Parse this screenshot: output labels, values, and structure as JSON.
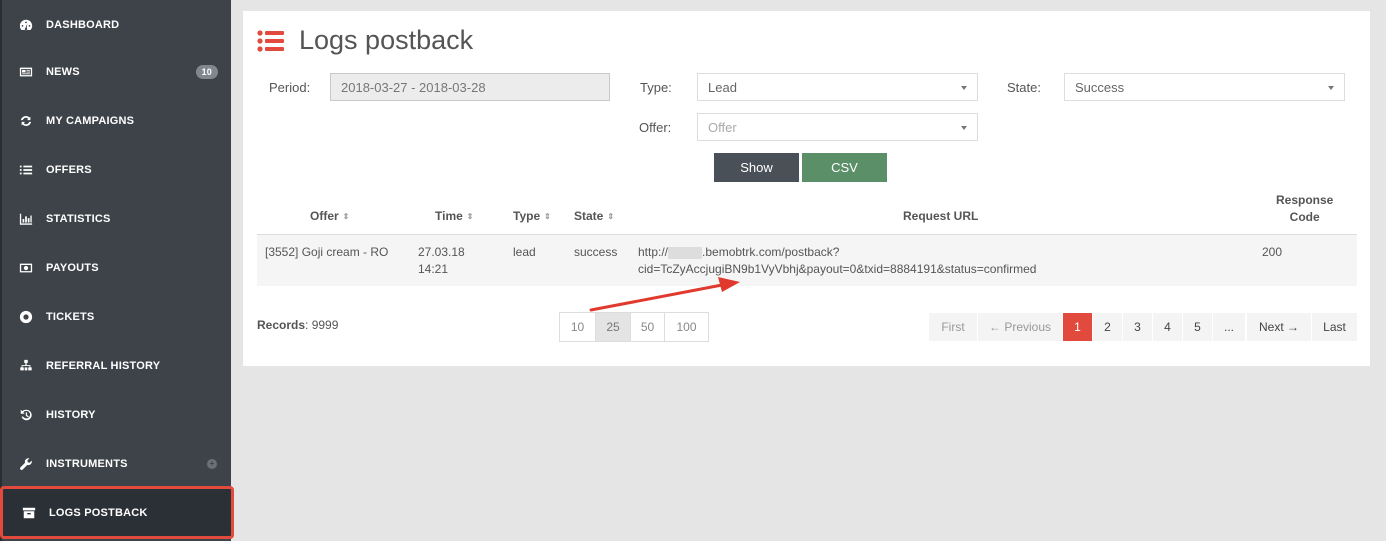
{
  "sidebar": {
    "items": [
      {
        "label": "DASHBOARD",
        "icon": "dashboard-icon"
      },
      {
        "label": "NEWS",
        "icon": "newspaper-icon",
        "badge": "10"
      },
      {
        "label": "MY CAMPAIGNS",
        "icon": "refresh-icon"
      },
      {
        "label": "OFFERS",
        "icon": "list-icon"
      },
      {
        "label": "STATISTICS",
        "icon": "bar-chart-icon"
      },
      {
        "label": "PAYOUTS",
        "icon": "money-icon"
      },
      {
        "label": "TICKETS",
        "icon": "lifebuoy-icon"
      },
      {
        "label": "REFERRAL HISTORY",
        "icon": "sitemap-icon"
      },
      {
        "label": "HISTORY",
        "icon": "history-icon"
      },
      {
        "label": "INSTRUMENTS",
        "icon": "wrench-icon"
      },
      {
        "label": "LOGS POSTBACK",
        "icon": "archive-icon"
      }
    ]
  },
  "page": {
    "title": "Logs postback",
    "accent_color": "#e14a3c"
  },
  "filters": {
    "period_label": "Period:",
    "period_value": "2018-03-27 - 2018-03-28",
    "type_label": "Type:",
    "type_value": "Lead",
    "state_label": "State:",
    "state_value": "Success",
    "offer_label": "Offer:",
    "offer_placeholder": "Offer",
    "show_label": "Show",
    "csv_label": "CSV"
  },
  "table": {
    "headers": {
      "offer": "Offer",
      "time": "Time",
      "type": "Type",
      "state": "State",
      "request_url": "Request URL",
      "response_code_1": "Response",
      "response_code_2": "Code"
    },
    "rows": [
      {
        "offer": "[3552] Goji cream - RO",
        "time_date": "27.03.18",
        "time_hour": "14:21",
        "type": "lead",
        "state": "success",
        "url_prefix": "http://",
        "url_rest": ".bemobtrk.com/postback?",
        "url_query": "cid=TcZyAccjugiBN9b1VyVbhj&payout=0&txid=8884191&status=confirmed",
        "response_code": "200"
      }
    ]
  },
  "footer": {
    "records_label": "Records",
    "records_value": ": 9999",
    "page_sizes": [
      "10",
      "25",
      "50",
      "100"
    ],
    "pagination": [
      "First",
      "← Previous",
      "1",
      "2",
      "3",
      "4",
      "5",
      "...",
      "Next →",
      "Last"
    ]
  }
}
